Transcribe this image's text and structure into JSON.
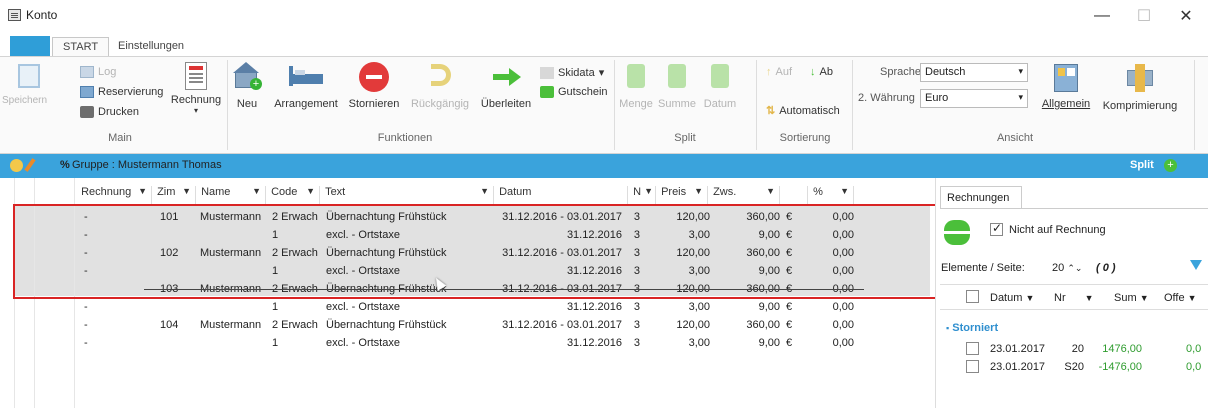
{
  "window": {
    "title": "Konto",
    "minimize": "—",
    "maximize": "☐",
    "close": "✕"
  },
  "ribbon_tabs": [
    "START",
    "Einstellungen"
  ],
  "main_group": {
    "label": "Main",
    "save": "Speichern",
    "log": "Log",
    "reservation": "Reservierung",
    "print": "Drucken",
    "invoice": "Rechnung"
  },
  "functions_group": {
    "label": "Funktionen",
    "new": "Neu",
    "arrangement": "Arrangement",
    "cancel": "Stornieren",
    "undo": "Rückgängig",
    "transfer": "Überleiten",
    "discount": "Skidata",
    "voucher": "Gutschein"
  },
  "split_group": {
    "label": "Split",
    "quantity": "Menge",
    "sum": "Summe",
    "date": "Datum"
  },
  "sort_group": {
    "label": "Sortierung",
    "asc": "Auf",
    "desc": "Ab",
    "auto": "Automatisch"
  },
  "view_group": {
    "label": "Ansicht",
    "language_label": "Sprache",
    "language_value": "Deutsch",
    "currency_label": "2. Währung",
    "currency_value": "Euro",
    "general": "Allgemein",
    "compress": "Komprimierung"
  },
  "groupbar": {
    "percent": "%",
    "text": "Gruppe : Mustermann Thomas",
    "split": "Split"
  },
  "grid": {
    "headers": [
      "Rechnung",
      "Zim",
      "Name",
      "Code",
      "Text",
      "Datum",
      "N",
      "Preis",
      "Zws.",
      "",
      "%"
    ],
    "rows": [
      {
        "inv": "-",
        "room": "101",
        "name": "Mustermann",
        "code": "2 Erwach",
        "text": "Übernachtung Frühstück",
        "date": "31.12.2016 - 03.01.2017",
        "n": "3",
        "price": "120,00",
        "sub": "360,00",
        "cur": "€",
        "pct": "0,00"
      },
      {
        "inv": "-",
        "room": "",
        "name": "",
        "code": "1",
        "text": "excl.  -  Ortstaxe",
        "date": "31.12.2016",
        "n": "3",
        "price": "3,00",
        "sub": "9,00",
        "cur": "€",
        "pct": "0,00"
      },
      {
        "inv": "-",
        "room": "102",
        "name": "Mustermann",
        "code": "2 Erwach",
        "text": "Übernachtung Frühstück",
        "date": "31.12.2016 - 03.01.2017",
        "n": "3",
        "price": "120,00",
        "sub": "360,00",
        "cur": "€",
        "pct": "0,00"
      },
      {
        "inv": "-",
        "room": "",
        "name": "",
        "code": "1",
        "text": "excl.  -  Ortstaxe",
        "date": "31.12.2016",
        "n": "3",
        "price": "3,00",
        "sub": "9,00",
        "cur": "€",
        "pct": "0,00"
      },
      {
        "inv": "",
        "room": "103",
        "name": "Mustermann",
        "code": "2 Erwach",
        "text": "Übernachtung Frühstück",
        "date": "31.12.2016 - 03.01.2017",
        "n": "3",
        "price": "120,00",
        "sub": "360,00",
        "cur": "€",
        "pct": "0,00"
      },
      {
        "inv": "-",
        "room": "",
        "name": "",
        "code": "1",
        "text": "excl.  -  Ortstaxe",
        "date": "31.12.2016",
        "n": "3",
        "price": "3,00",
        "sub": "9,00",
        "cur": "€",
        "pct": "0,00"
      },
      {
        "inv": "-",
        "room": "104",
        "name": "Mustermann",
        "code": "2 Erwach",
        "text": "Übernachtung Frühstück",
        "date": "31.12.2016 - 03.01.2017",
        "n": "3",
        "price": "120,00",
        "sub": "360,00",
        "cur": "€",
        "pct": "0,00"
      },
      {
        "inv": "-",
        "room": "",
        "name": "",
        "code": "1",
        "text": "excl.  -  Ortstaxe",
        "date": "31.12.2016",
        "n": "3",
        "price": "3,00",
        "sub": "9,00",
        "cur": "€",
        "pct": "0,00"
      }
    ]
  },
  "invoices_panel": {
    "tab": "Rechnungen",
    "not_on_invoice": "Nicht auf Rechnung",
    "per_page_label": "Elemente / Seite:",
    "per_page_value": "20",
    "count": "( 0 )",
    "headers": [
      "Datum",
      "Nr",
      "Sum",
      "Offe"
    ],
    "group": "Storniert",
    "rows": [
      {
        "date": "23.01.2017",
        "nr": "20",
        "sum": "1476,00",
        "open": "0,0"
      },
      {
        "date": "23.01.2017",
        "nr": "S20",
        "sum": "-1476,00",
        "open": "0,0"
      }
    ]
  },
  "colors": {
    "accent": "#3aa3dc",
    "selection": "#e1e1e1",
    "highlight_box": "#d92424",
    "green": "#2f9c2f"
  }
}
